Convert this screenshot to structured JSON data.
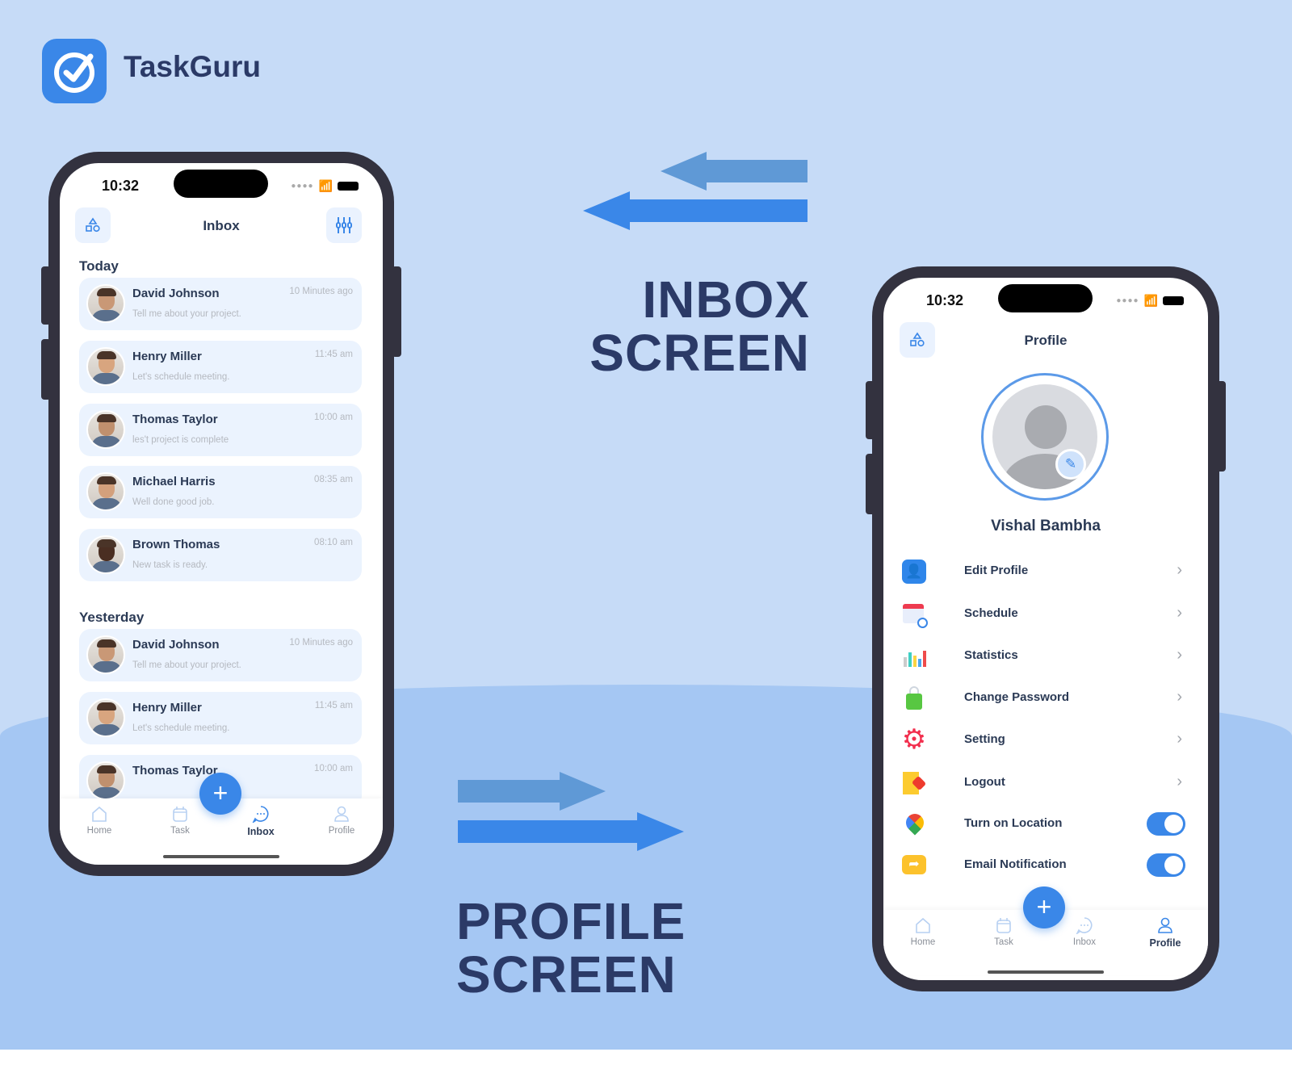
{
  "brand": {
    "name": "TaskGuru",
    "color": "#3a87e8"
  },
  "captions": {
    "inbox": [
      "INBOX",
      "SCREEN"
    ],
    "profile": [
      "PROFILE",
      "SCREEN"
    ]
  },
  "inbox": {
    "status_time": "10:32",
    "title": "Inbox",
    "sections": [
      {
        "label": "Today",
        "messages": [
          {
            "name": "David Johnson",
            "text": "Tell me about your project.",
            "time": "10 Minutes ago"
          },
          {
            "name": "Henry Miller",
            "text": "Let's schedule meeting.",
            "time": "11:45 am"
          },
          {
            "name": "Thomas Taylor",
            "text": "les't project is complete",
            "time": "10:00 am"
          },
          {
            "name": "Michael Harris",
            "text": "Well done good job.",
            "time": "08:35 am"
          },
          {
            "name": "Brown Thomas",
            "text": "New task is ready.",
            "time": "08:10 am"
          }
        ]
      },
      {
        "label": "Yesterday",
        "messages": [
          {
            "name": "David Johnson",
            "text": "Tell me about your project.",
            "time": "10 Minutes ago"
          },
          {
            "name": "Henry Miller",
            "text": "Let's schedule meeting.",
            "time": "11:45 am"
          },
          {
            "name": "Thomas Taylor",
            "text": "",
            "time": "10:00 am"
          }
        ]
      }
    ],
    "nav": [
      {
        "label": "Home",
        "icon": "home-icon"
      },
      {
        "label": "Task",
        "icon": "calendar-icon"
      },
      {
        "label": "Inbox",
        "icon": "chat-icon",
        "active": true
      },
      {
        "label": "Profile",
        "icon": "user-icon"
      }
    ],
    "fab": "+"
  },
  "profile": {
    "status_time": "10:32",
    "title": "Profile",
    "user_name": "Vishal Bambha",
    "menu": [
      {
        "label": "Edit Profile",
        "icon": "edit-profile-icon",
        "type": "link"
      },
      {
        "label": "Schedule",
        "icon": "schedule-icon",
        "type": "link"
      },
      {
        "label": "Statistics",
        "icon": "statistics-icon",
        "type": "link"
      },
      {
        "label": "Change Password",
        "icon": "lock-icon",
        "type": "link"
      },
      {
        "label": "Setting",
        "icon": "gear-icon",
        "type": "link"
      },
      {
        "label": "Logout",
        "icon": "logout-icon",
        "type": "link"
      },
      {
        "label": "Turn on Location",
        "icon": "location-icon",
        "type": "toggle",
        "on": true
      },
      {
        "label": "Email Notification",
        "icon": "email-notification-icon",
        "type": "toggle",
        "on": true
      }
    ],
    "nav": [
      {
        "label": "Home",
        "icon": "home-icon"
      },
      {
        "label": "Task",
        "icon": "calendar-icon"
      },
      {
        "label": "Inbox",
        "icon": "chat-icon"
      },
      {
        "label": "Profile",
        "icon": "user-icon",
        "active": true
      }
    ],
    "fab": "+"
  }
}
